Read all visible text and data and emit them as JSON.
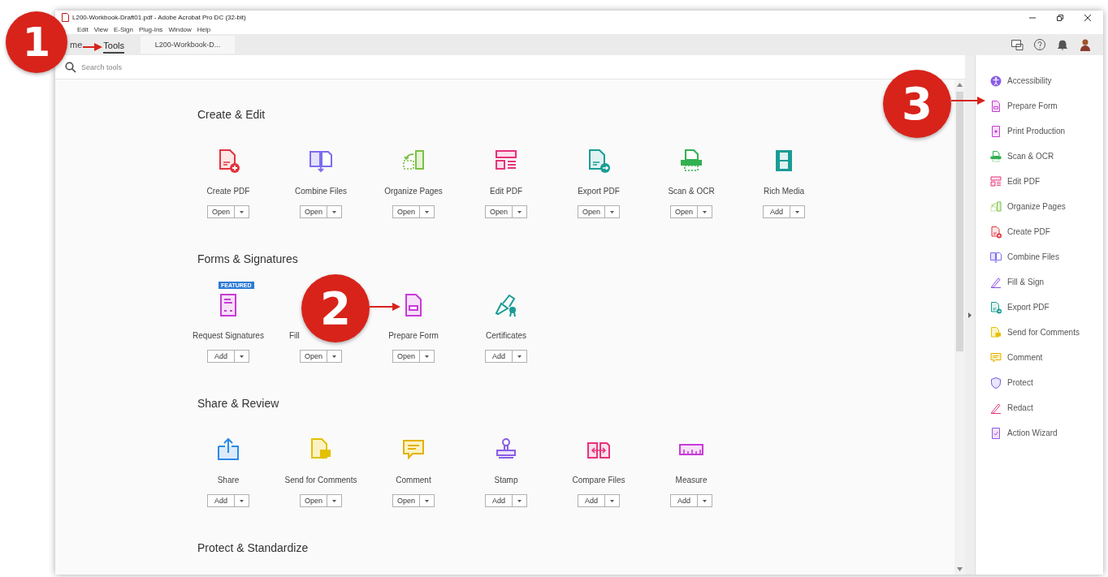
{
  "window": {
    "title": "L200-Workbook-Draft01.pdf - Adobe Acrobat Pro DC (32-bit)"
  },
  "menu": [
    "Edit",
    "View",
    "E-Sign",
    "Plug-Ins",
    "Window",
    "Help"
  ],
  "tabs": [
    {
      "label": "me",
      "selected": false,
      "kind": "plain"
    },
    {
      "label": "Tools",
      "selected": true,
      "kind": "plain"
    },
    {
      "label": "L200-Workbook-D...",
      "selected": false,
      "kind": "document"
    }
  ],
  "search": {
    "placeholder": "Search tools"
  },
  "sections": [
    {
      "title": "Create & Edit",
      "tools": [
        {
          "label": "Create PDF",
          "action": "Open"
        },
        {
          "label": "Combine Files",
          "action": "Open"
        },
        {
          "label": "Organize Pages",
          "action": "Open"
        },
        {
          "label": "Edit PDF",
          "action": "Open"
        },
        {
          "label": "Export PDF",
          "action": "Open"
        },
        {
          "label": "Scan & OCR",
          "action": "Open"
        },
        {
          "label": "Rich Media",
          "action": "Add"
        }
      ]
    },
    {
      "title": "Forms & Signatures",
      "tools": [
        {
          "label": "Request Signatures",
          "action": "Add",
          "badge": "FEATURED"
        },
        {
          "label": "Fill",
          "action": "Open"
        },
        {
          "label": "Prepare Form",
          "action": "Open"
        },
        {
          "label": "Certificates",
          "action": "Add"
        }
      ]
    },
    {
      "title": "Share & Review",
      "tools": [
        {
          "label": "Share",
          "action": "Add"
        },
        {
          "label": "Send for Comments",
          "action": "Open"
        },
        {
          "label": "Comment",
          "action": "Open"
        },
        {
          "label": "Stamp",
          "action": "Add"
        },
        {
          "label": "Compare Files",
          "action": "Add"
        },
        {
          "label": "Measure",
          "action": "Add"
        }
      ]
    },
    {
      "title": "Protect & Standardize"
    }
  ],
  "right_panel": [
    {
      "label": "Accessibility"
    },
    {
      "label": "Prepare Form"
    },
    {
      "label": "Print Production"
    },
    {
      "label": "Scan & OCR"
    },
    {
      "label": "Edit PDF"
    },
    {
      "label": "Organize Pages"
    },
    {
      "label": "Create PDF"
    },
    {
      "label": "Combine Files"
    },
    {
      "label": "Fill & Sign"
    },
    {
      "label": "Export PDF"
    },
    {
      "label": "Send for Comments"
    },
    {
      "label": "Comment"
    },
    {
      "label": "Protect"
    },
    {
      "label": "Redact"
    },
    {
      "label": "Action Wizard"
    }
  ],
  "callouts": [
    {
      "number": "1"
    },
    {
      "number": "2"
    },
    {
      "number": "3"
    }
  ]
}
